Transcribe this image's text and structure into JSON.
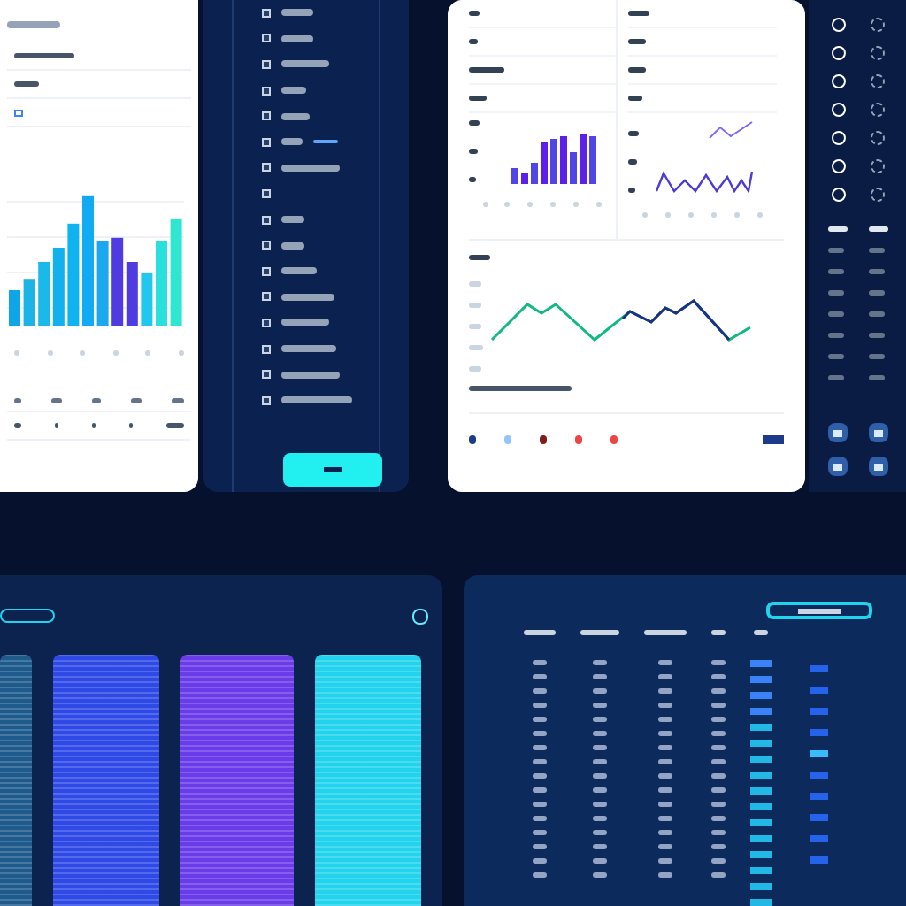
{
  "left_card": {
    "fields": [
      {
        "kind": "line"
      },
      {
        "kind": "line"
      },
      {
        "kind": "icon"
      }
    ],
    "chart": {
      "kind": "bar"
    }
  },
  "menu": {
    "items": [
      {
        "kind": "entry"
      },
      {
        "kind": "entry"
      },
      {
        "kind": "entry"
      },
      {
        "kind": "entry"
      },
      {
        "kind": "entry"
      },
      {
        "kind": "marked"
      },
      {
        "kind": "entry"
      },
      {
        "kind": "blank"
      },
      {
        "kind": "entry"
      },
      {
        "kind": "entry"
      },
      {
        "kind": "entry"
      },
      {
        "kind": "entry"
      },
      {
        "kind": "entry"
      },
      {
        "kind": "entry"
      },
      {
        "kind": "entry"
      },
      {
        "kind": "entry"
      }
    ],
    "button": {
      "kind": "primary"
    }
  },
  "analytics_card": {
    "panels": [
      {
        "kind": "bar"
      },
      {
        "kind": "line"
      }
    ],
    "trend": {
      "kind": "line"
    },
    "footer": [
      {
        "color": "#1e3a8a"
      },
      {
        "color": "#93c5fd"
      },
      {
        "color": "#7f1d1d"
      },
      {
        "color": "#ef4444"
      },
      {
        "color": "#ef4444"
      }
    ]
  },
  "icon_strip": {
    "buttons": [
      {
        "kind": "square"
      },
      {
        "kind": "square"
      },
      {
        "kind": "square"
      },
      {
        "kind": "square"
      }
    ]
  },
  "spectrum_panel": {
    "columns": [
      {
        "color": "#1e5a8c"
      },
      {
        "color": "#2f49e6"
      },
      {
        "color": "#6a3be8"
      },
      {
        "color": "#22d3ee"
      }
    ]
  },
  "table_panel": {
    "columns": [
      {
        "kind": "text"
      },
      {
        "kind": "text"
      },
      {
        "kind": "text"
      },
      {
        "kind": "text"
      },
      {
        "kind": "badge"
      }
    ]
  }
}
